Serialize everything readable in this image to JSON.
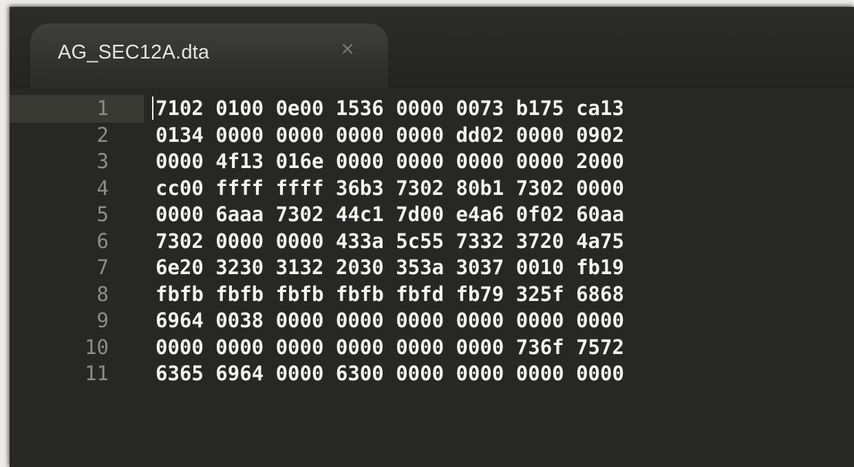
{
  "tab": {
    "title": "AG_SEC12A.dta",
    "close_glyph": "×",
    "close_icon": "close-icon"
  },
  "editor": {
    "current_line": 1,
    "lines": [
      {
        "number": "1",
        "text": "7102 0100 0e00 1536 0000 0073 b175 ca13"
      },
      {
        "number": "2",
        "text": "0134 0000 0000 0000 0000 dd02 0000 0902"
      },
      {
        "number": "3",
        "text": "0000 4f13 016e 0000 0000 0000 0000 2000"
      },
      {
        "number": "4",
        "text": "cc00 ffff ffff 36b3 7302 80b1 7302 0000"
      },
      {
        "number": "5",
        "text": "0000 6aaa 7302 44c1 7d00 e4a6 0f02 60aa"
      },
      {
        "number": "6",
        "text": "7302 0000 0000 433a 5c55 7332 3720 4a75"
      },
      {
        "number": "7",
        "text": "6e20 3230 3132 2030 353a 3037 0010 fb19"
      },
      {
        "number": "8",
        "text": "fbfb fbfb fbfb fbfb fbfd fb79 325f 6868"
      },
      {
        "number": "9",
        "text": "6964 0038 0000 0000 0000 0000 0000 0000"
      },
      {
        "number": "10",
        "text": "0000 0000 0000 0000 0000 0000 736f 7572"
      },
      {
        "number": "11",
        "text": "6365 6964 0000 6300 0000 0000 0000 0000"
      }
    ]
  },
  "colors": {
    "background": "#1d1d1c",
    "editor_background": "#272725",
    "text": "#f3f3f0",
    "line_number": "#8d8d88",
    "current_line_highlight": "#3a3a35"
  }
}
